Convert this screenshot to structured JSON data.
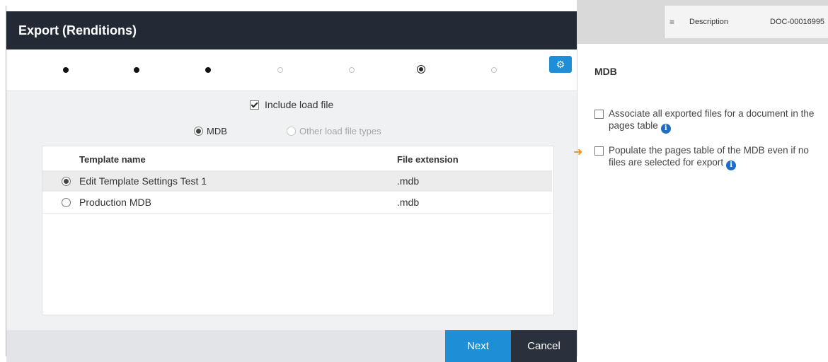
{
  "background": {
    "row_label": "Description",
    "row_value": "DOC-00016995",
    "list_icon": "list-icon"
  },
  "dialog": {
    "title": "Export (Renditions)",
    "steps": [
      "done",
      "done",
      "done",
      "todo",
      "todo",
      "current",
      "todo"
    ],
    "settings_icon": "gear-icon",
    "include_load_file": {
      "label": "Include load file",
      "checked": true
    },
    "load_file_types": {
      "mdb": {
        "label": "MDB",
        "selected": true
      },
      "other": {
        "label": "Other load file types",
        "selected": false,
        "disabled": true
      }
    },
    "table": {
      "headers": [
        "Template name",
        "File extension"
      ],
      "rows": [
        {
          "name": "Edit Template Settings Test 1",
          "ext": ".mdb",
          "selected": true
        },
        {
          "name": "Production MDB",
          "ext": ".mdb",
          "selected": false
        }
      ]
    },
    "buttons": {
      "next": "Next",
      "cancel": "Cancel"
    }
  },
  "panel": {
    "title": "MDB",
    "options": [
      {
        "text": "Associate all exported files for a document in the pages table",
        "checked": false
      },
      {
        "text": "Populate the pages table of the MDB even if no files are selected for export",
        "checked": false
      }
    ]
  },
  "colors": {
    "header_bg": "#232a36",
    "primary": "#1e8ed6",
    "cancel_bg": "#2b313c",
    "info_icon": "#1f6ec5",
    "pointer_arrow": "#f39318"
  }
}
